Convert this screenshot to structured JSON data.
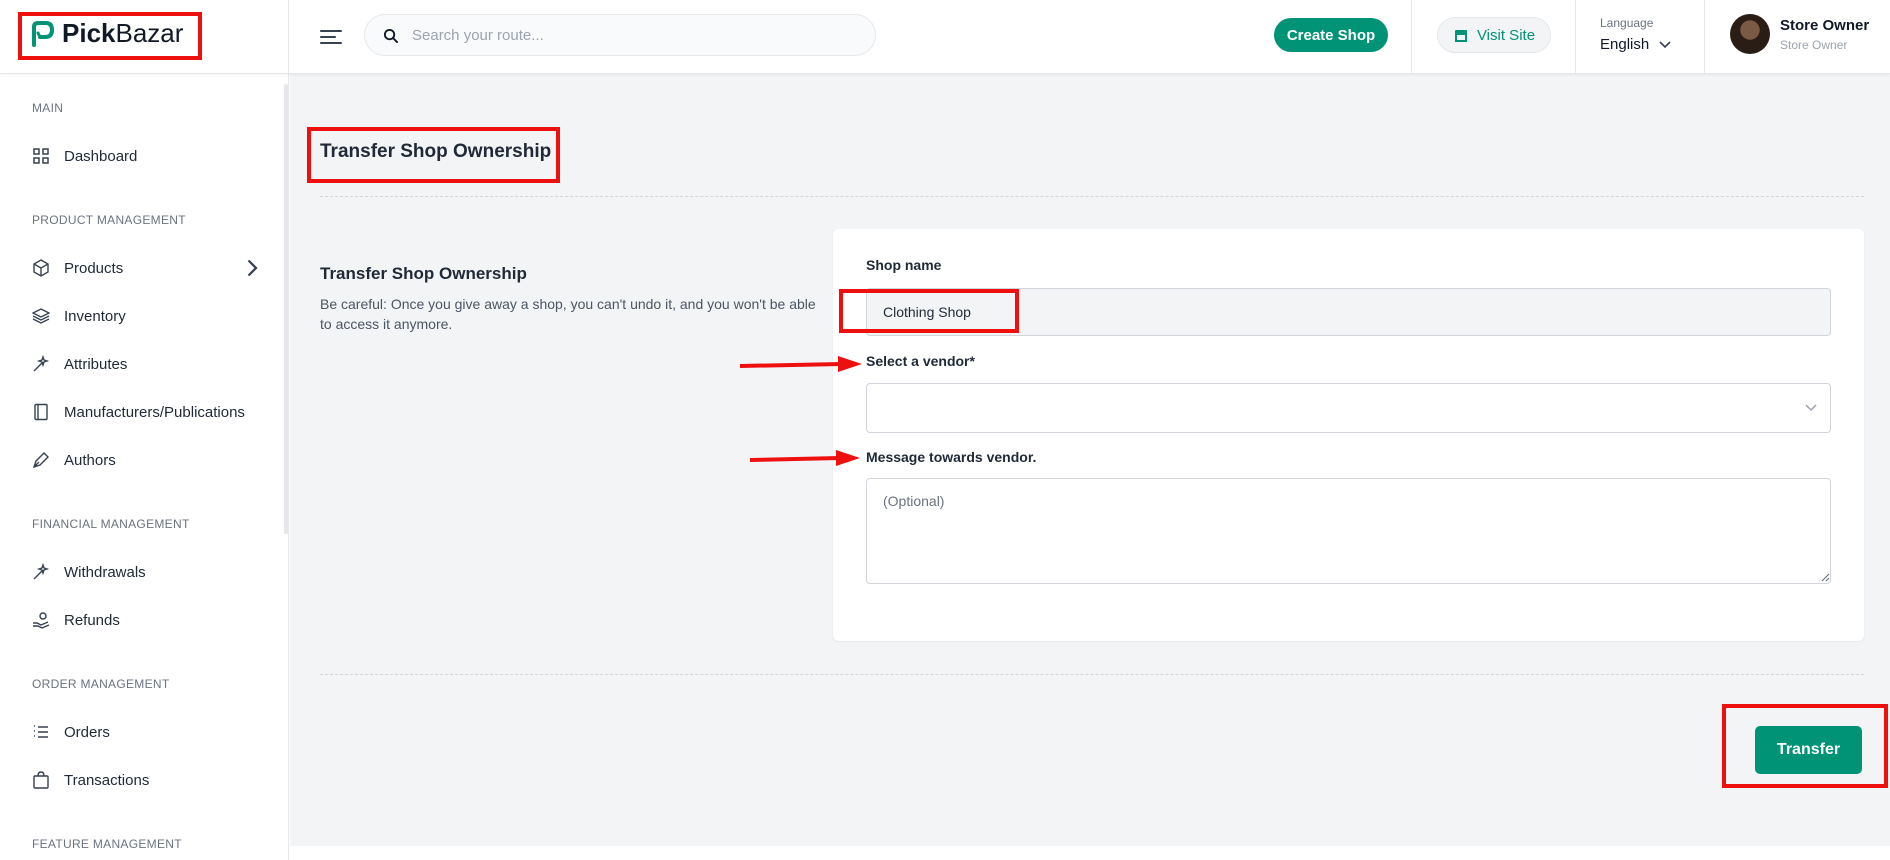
{
  "header": {
    "logo_bold": "Pick",
    "logo_rest": "Bazar",
    "search_placeholder": "Search your route...",
    "create_shop_label": "Create Shop",
    "visit_site_label": "Visit Site",
    "language_label": "Language",
    "language_value": "English",
    "user_name": "Store Owner",
    "user_role": "Store Owner"
  },
  "sidebar": {
    "sections": [
      {
        "title": "MAIN",
        "items": [
          {
            "label": "Dashboard",
            "icon": "dashboard-icon"
          }
        ]
      },
      {
        "title": "PRODUCT MANAGEMENT",
        "items": [
          {
            "label": "Products",
            "icon": "box-icon",
            "has_chevron": true
          },
          {
            "label": "Inventory",
            "icon": "layers-icon"
          },
          {
            "label": "Attributes",
            "icon": "wand-icon"
          },
          {
            "label": "Manufacturers/Publications",
            "icon": "book-icon"
          },
          {
            "label": "Authors",
            "icon": "pen-icon"
          }
        ]
      },
      {
        "title": "FINANCIAL MANAGEMENT",
        "items": [
          {
            "label": "Withdrawals",
            "icon": "wand-icon"
          },
          {
            "label": "Refunds",
            "icon": "hand-coin-icon"
          }
        ]
      },
      {
        "title": "ORDER MANAGEMENT",
        "items": [
          {
            "label": "Orders",
            "icon": "list-icon"
          },
          {
            "label": "Transactions",
            "icon": "bag-icon"
          }
        ]
      },
      {
        "title": "FEATURE MANAGEMENT",
        "items": []
      }
    ]
  },
  "main": {
    "page_title": "Transfer Shop Ownership",
    "section_title": "Transfer Shop Ownership",
    "section_description": "Be careful: Once you give away a shop, you can't undo it, and you won't be able to access it anymore.",
    "shop_name_label": "Shop name",
    "shop_name_value": "Clothing Shop",
    "vendor_label": "Select a vendor*",
    "vendor_value": "",
    "message_label": "Message towards vendor.",
    "message_placeholder": "(Optional)",
    "transfer_label": "Transfer"
  },
  "colors": {
    "brand": "#019376",
    "annotation": "#ee0f0f"
  }
}
